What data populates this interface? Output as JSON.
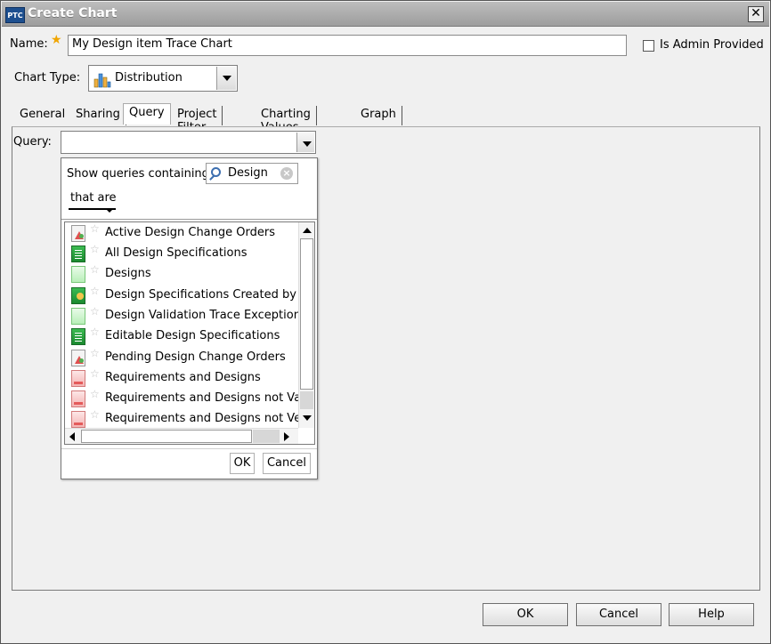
{
  "window": {
    "title": "Create Chart",
    "logo_text": "PTC",
    "close_glyph": "✕"
  },
  "form": {
    "name_label": "Name:",
    "name_value": "My Design item Trace Chart",
    "admin_label": "Is Admin Provided",
    "admin_checked": false,
    "chart_type_label": "Chart Type:",
    "chart_type_value": "Distribution"
  },
  "tabs": [
    {
      "label": "General",
      "active": false
    },
    {
      "label": "Sharing",
      "active": false
    },
    {
      "label": "Query",
      "active": true
    },
    {
      "label": "Project Filter",
      "active": false
    },
    {
      "label": "Charting Values",
      "active": false
    },
    {
      "label": "Graph",
      "active": false
    }
  ],
  "query": {
    "label": "Query:",
    "value": "",
    "popup": {
      "show_label": "Show queries containing",
      "search_value": "Design",
      "filter_label": "that are",
      "items": [
        {
          "label": "Active Design Change Orders",
          "icon": "change-order-icon"
        },
        {
          "label": "All Design Specifications",
          "icon": "green-document-icon"
        },
        {
          "label": "Designs",
          "icon": "light-green-document-icon"
        },
        {
          "label": "Design Specifications Created by -",
          "icon": "document-person-icon"
        },
        {
          "label": "Design Validation Trace Exceptions",
          "icon": "light-green-document-icon"
        },
        {
          "label": "Editable Design Specifications",
          "icon": "green-document-icon"
        },
        {
          "label": "Pending Design Change Orders",
          "icon": "change-order-icon"
        },
        {
          "label": "Requirements and Designs",
          "icon": "red-document-icon"
        },
        {
          "label": "Requirements and Designs not Vali",
          "icon": "red-document-icon"
        },
        {
          "label": "Requirements and Designs not Ver",
          "icon": "red-document-icon"
        }
      ],
      "ok_label": "OK",
      "cancel_label": "Cancel"
    }
  },
  "footer": {
    "ok_label": "OK",
    "cancel_label": "Cancel",
    "help_label": "Help"
  }
}
